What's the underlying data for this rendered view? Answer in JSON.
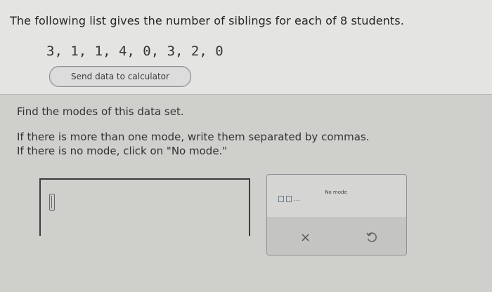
{
  "problem": {
    "prompt": "The following list gives the number of siblings for each of 8 students.",
    "dataset": "3, 1, 1, 4, 0, 3, 2, 0",
    "send_button_label": "Send data to calculator"
  },
  "question": "Find the modes of this data set.",
  "instructions": {
    "line1": "If there is more than one mode, write them separated by commas.",
    "line2": "If there is no mode, click on \"No mode.\""
  },
  "keypad": {
    "mode_set_icon": "set-of-boxes-icon",
    "mode_set_dots": "...",
    "no_mode_label": "No mode",
    "clear_icon": "x-icon",
    "clear_glyph": "×",
    "undo_icon": "undo-icon"
  },
  "colors": {
    "background": "#cfd0cc",
    "top_background": "#e4e5e2",
    "keypad_accent": "#6d7a90"
  }
}
